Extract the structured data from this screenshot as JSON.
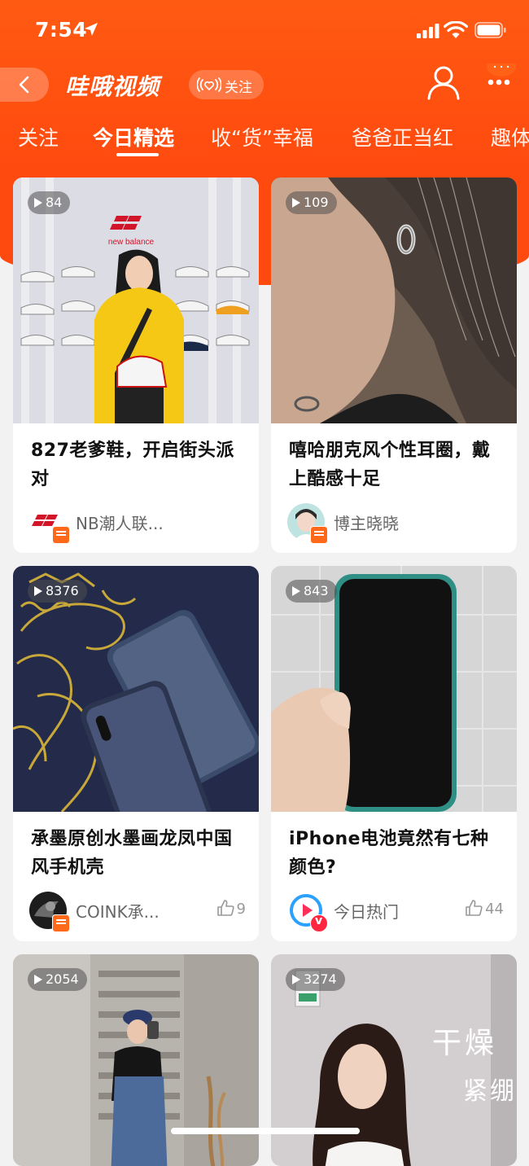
{
  "status_bar": {
    "time": "7:54"
  },
  "nav": {
    "title": "哇哦视频",
    "follow_label": "关注"
  },
  "tabs": [
    {
      "label": "关注"
    },
    {
      "label": "今日精选"
    },
    {
      "label": "收“货”幸福"
    },
    {
      "label": "爸爸正当红"
    },
    {
      "label": "趣体"
    }
  ],
  "cards": [
    {
      "views": "84",
      "title": "827老爹鞋，开启街头派对",
      "author": "NB潮人联...",
      "likes": ""
    },
    {
      "views": "109",
      "title": "嘻哈朋克风个性耳圈，戴上酷感十足",
      "author": "博主晓晓",
      "likes": ""
    },
    {
      "views": "8376",
      "title": "承墨原创水墨画龙凤中国风手机壳",
      "author": "COINK承...",
      "likes": "9"
    },
    {
      "views": "843",
      "title": "iPhone电池竟然有七种颜色?",
      "author": "今日热门",
      "likes": "44"
    },
    {
      "views": "2054",
      "title": "",
      "author": "",
      "likes": ""
    },
    {
      "views": "3274",
      "title": "",
      "author": "",
      "likes": "",
      "overlay_text": [
        "干燥",
        "紧绷"
      ]
    }
  ],
  "thumbnail_brand": "new balance",
  "colors": {
    "brand_orange": "#ff4a0f",
    "badge_orange": "#ff6a1a"
  }
}
